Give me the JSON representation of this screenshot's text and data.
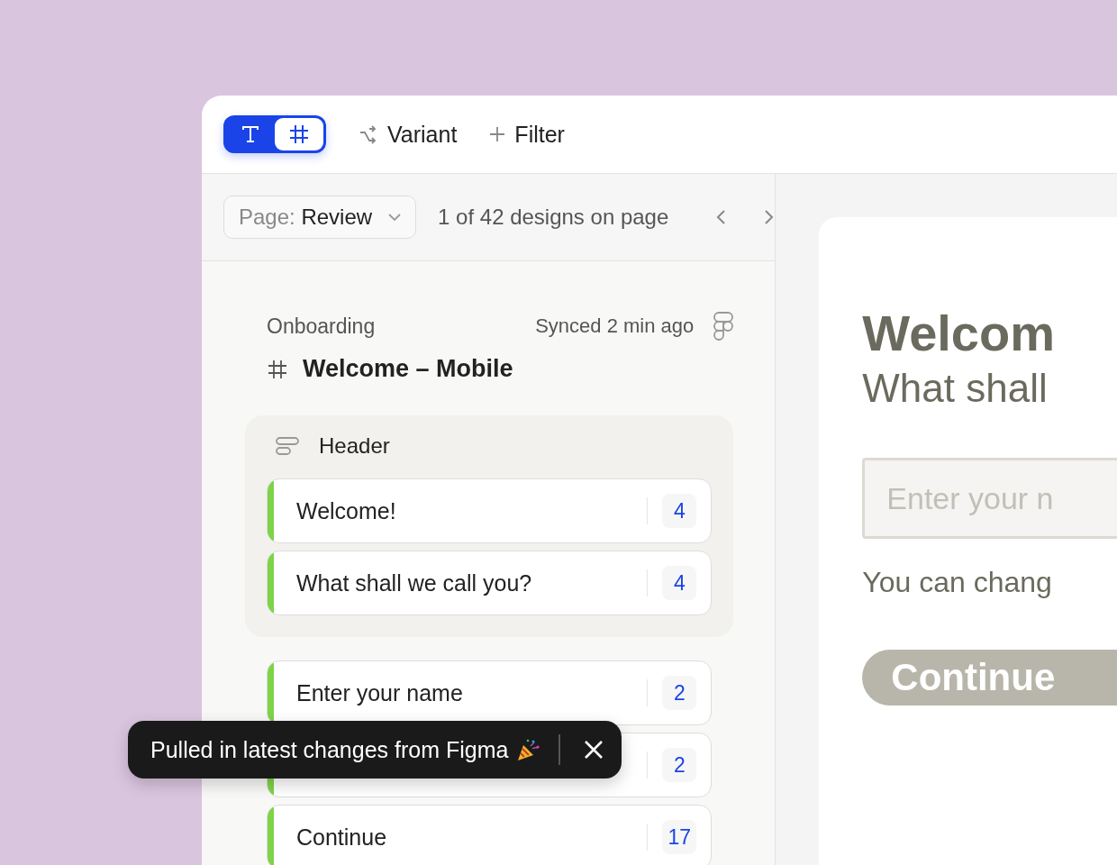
{
  "toolbar": {
    "mode_toggle": [
      {
        "kind": "text",
        "selected": false
      },
      {
        "kind": "frame",
        "selected": true
      }
    ],
    "actions": [
      {
        "kind": "variant",
        "label": "Variant"
      },
      {
        "kind": "filter",
        "label": "Filter"
      }
    ]
  },
  "nav": {
    "page_label": "Page:",
    "page_value": "Review",
    "counter": "1 of 42 designs on page"
  },
  "design": {
    "section": "Onboarding",
    "sync_status": "Synced 2 min ago",
    "title": "Welcome – Mobile"
  },
  "groups": [
    {
      "kind": "group",
      "name": "Header",
      "items": [
        {
          "text": "Welcome!",
          "count": "4"
        },
        {
          "text": "What shall we call you?",
          "count": "4"
        }
      ]
    },
    {
      "kind": "loose",
      "items": [
        {
          "text": "Enter your name",
          "count": "2"
        },
        {
          "count": "2"
        },
        {
          "text": "Continue",
          "count": "17"
        }
      ]
    }
  ],
  "toast": {
    "message": "Pulled in latest changes from Figma"
  },
  "preview": {
    "title": "Welcom",
    "subtitle": "What shall",
    "input_placeholder": "Enter your n",
    "helper": "You can chang",
    "button": "Continue"
  }
}
